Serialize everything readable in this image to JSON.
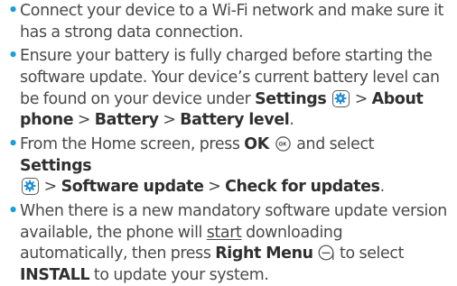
{
  "bullets": [
    {
      "text": "Connect your device to a Wi-Fi network and make sure it has a strong data connection."
    },
    {
      "text_before": "Ensure your battery is fully charged before starting the software update. Your device’s current battery level can be found on your device under ",
      "settings": "Settings",
      "sep1": " > ",
      "about_phone": "About phone",
      "sep2": " > ",
      "battery": "Battery",
      "sep3": " > ",
      "battery_level": "Battery level",
      "end": "."
    },
    {
      "text_before": "From the Home screen, press ",
      "ok": "OK",
      "mid": " and select ",
      "settings": "Settings",
      "sep1": " > ",
      "software_update": "Software update",
      "sep2": " > ",
      "check_updates": "Check for updates",
      "end": "."
    },
    {
      "text_before": "When there is a new mandatory software update version available, the phone will ",
      "start": "start",
      "text_mid": " downloading automatically, then press ",
      "right_menu": "Right Menu",
      "text_mid2": " to select ",
      "install": "INSTALL",
      "text_end": " to update your system."
    }
  ],
  "icons": {
    "settings": "settings-gear-icon",
    "ok_key": "ok-key-icon",
    "right_menu_key": "right-menu-key-icon"
  },
  "colors": {
    "bullet": "#19a0d8",
    "gear": "#1e8fd6",
    "text": "#4a4a4a"
  }
}
